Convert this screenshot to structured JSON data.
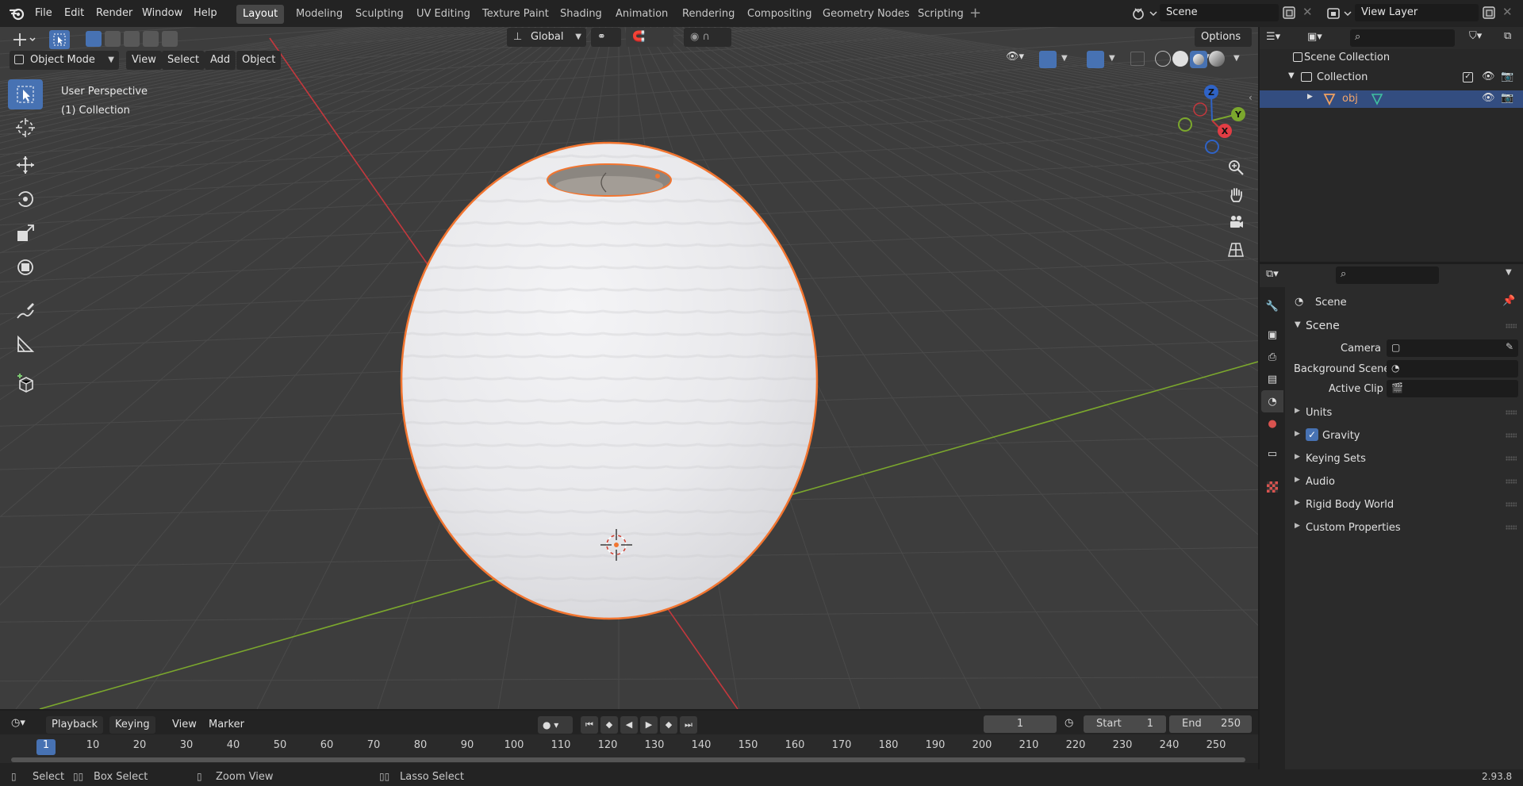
{
  "topbar": {
    "menus": [
      "File",
      "Edit",
      "Render",
      "Window",
      "Help"
    ],
    "workspaces": [
      "Layout",
      "Modeling",
      "Sculpting",
      "UV Editing",
      "Texture Paint",
      "Shading",
      "Animation",
      "Rendering",
      "Compositing",
      "Geometry Nodes",
      "Scripting"
    ],
    "active_workspace": "Layout",
    "scene_name": "Scene",
    "view_layer_name": "View Layer"
  },
  "viewport_header": {
    "transform_orientation": "Global",
    "options_label": "Options",
    "mode": "Object Mode",
    "menus": [
      "View",
      "Select",
      "Add",
      "Object"
    ]
  },
  "viewport": {
    "view_name": "User Perspective",
    "collection_label": "(1) Collection",
    "axis_labels": {
      "x": "X",
      "y": "Y",
      "z": "Z"
    }
  },
  "outliner": {
    "scene_collection": "Scene Collection",
    "collection": "Collection",
    "object": "obj"
  },
  "properties": {
    "context_name": "Scene",
    "section": "Scene",
    "fields": [
      {
        "label": "Camera",
        "value": ""
      },
      {
        "label": "Background Scene",
        "value": ""
      },
      {
        "label": "Active Clip",
        "value": ""
      }
    ],
    "subpanels": [
      "Units",
      "Gravity",
      "Keying Sets",
      "Audio",
      "Rigid Body World",
      "Custom Properties"
    ],
    "gravity_enabled": true
  },
  "timeline": {
    "menus": [
      "Playback",
      "Keying",
      "View",
      "Marker"
    ],
    "current_frame": "1",
    "start_label": "Start",
    "start_value": "1",
    "end_label": "End",
    "end_value": "250",
    "ruler": [
      "1",
      "10",
      "20",
      "30",
      "40",
      "50",
      "60",
      "70",
      "80",
      "90",
      "100",
      "110",
      "120",
      "130",
      "140",
      "150",
      "160",
      "170",
      "180",
      "190",
      "200",
      "210",
      "220",
      "230",
      "240",
      "250"
    ]
  },
  "statusbar": {
    "items": [
      "Select",
      "Box Select",
      "Zoom View",
      "Lasso Select"
    ],
    "version": "2.93.8"
  },
  "colors": {
    "accent": "#4772b3",
    "selection_outline": "#f27530",
    "x_axis": "#c4383d",
    "y_axis": "#7ba72d"
  }
}
